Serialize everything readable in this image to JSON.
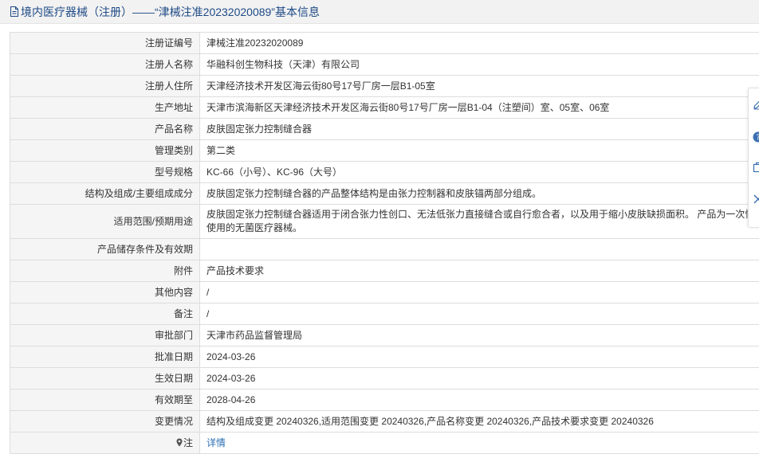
{
  "header": {
    "title": "境内医疗器械（注册）——“津械注准20232020089”基本信息"
  },
  "rows": [
    {
      "label": "注册证编号",
      "value": "津械注准20232020089"
    },
    {
      "label": "注册人名称",
      "value": "华融科创生物科技（天津）有限公司"
    },
    {
      "label": "注册人住所",
      "value": "天津经济技术开发区海云街80号17号厂房一层B1-05室"
    },
    {
      "label": "生产地址",
      "value": "天津市滨海新区天津经济技术开发区海云街80号17号厂房一层B1-04（注塑间）室、05室、06室"
    },
    {
      "label": "产品名称",
      "value": "皮肤固定张力控制缝合器"
    },
    {
      "label": "管理类别",
      "value": "第二类"
    },
    {
      "label": "型号规格",
      "value": "KC-66（小号）、KC-96（大号）"
    },
    {
      "label": "结构及组成/主要组成成分",
      "value": "皮肤固定张力控制缝合器的产品整体结构是由张力控制器和皮肤锚两部分组成。"
    },
    {
      "label": "适用范围/预期用途",
      "value": "皮肤固定张力控制缝合器适用于闭合张力性创口、无法低张力直接缝合或自行愈合者，以及用于缩小皮肤缺损面积。 产品为一次性使用的无菌医疗器械。"
    },
    {
      "label": "产品储存条件及有效期",
      "value": ""
    },
    {
      "label": "附件",
      "value": "产品技术要求"
    },
    {
      "label": "其他内容",
      "value": "/"
    },
    {
      "label": "备注",
      "value": "/"
    },
    {
      "label": "审批部门",
      "value": "天津市药品监督管理局"
    },
    {
      "label": "批准日期",
      "value": "2024-03-26"
    },
    {
      "label": "生效日期",
      "value": "2024-03-26"
    },
    {
      "label": "有效期至",
      "value": "2028-04-26"
    },
    {
      "label": "变更情况",
      "value": "结构及组成变更 20240326,适用范围变更 20240326,产品名称变更 20240326,产品技术要求变更 20240326"
    }
  ],
  "note_row": {
    "label": "注",
    "link_text": "详情"
  },
  "icons": [
    "document-icon",
    "map-pin-icon",
    "edit-icon",
    "help-icon",
    "copy-icon",
    "close-icon"
  ],
  "colors": {
    "title_text": "#1e4a86",
    "link": "#2a6fb5",
    "label_bg": "#f5f5f5",
    "border": "#dddddd"
  }
}
